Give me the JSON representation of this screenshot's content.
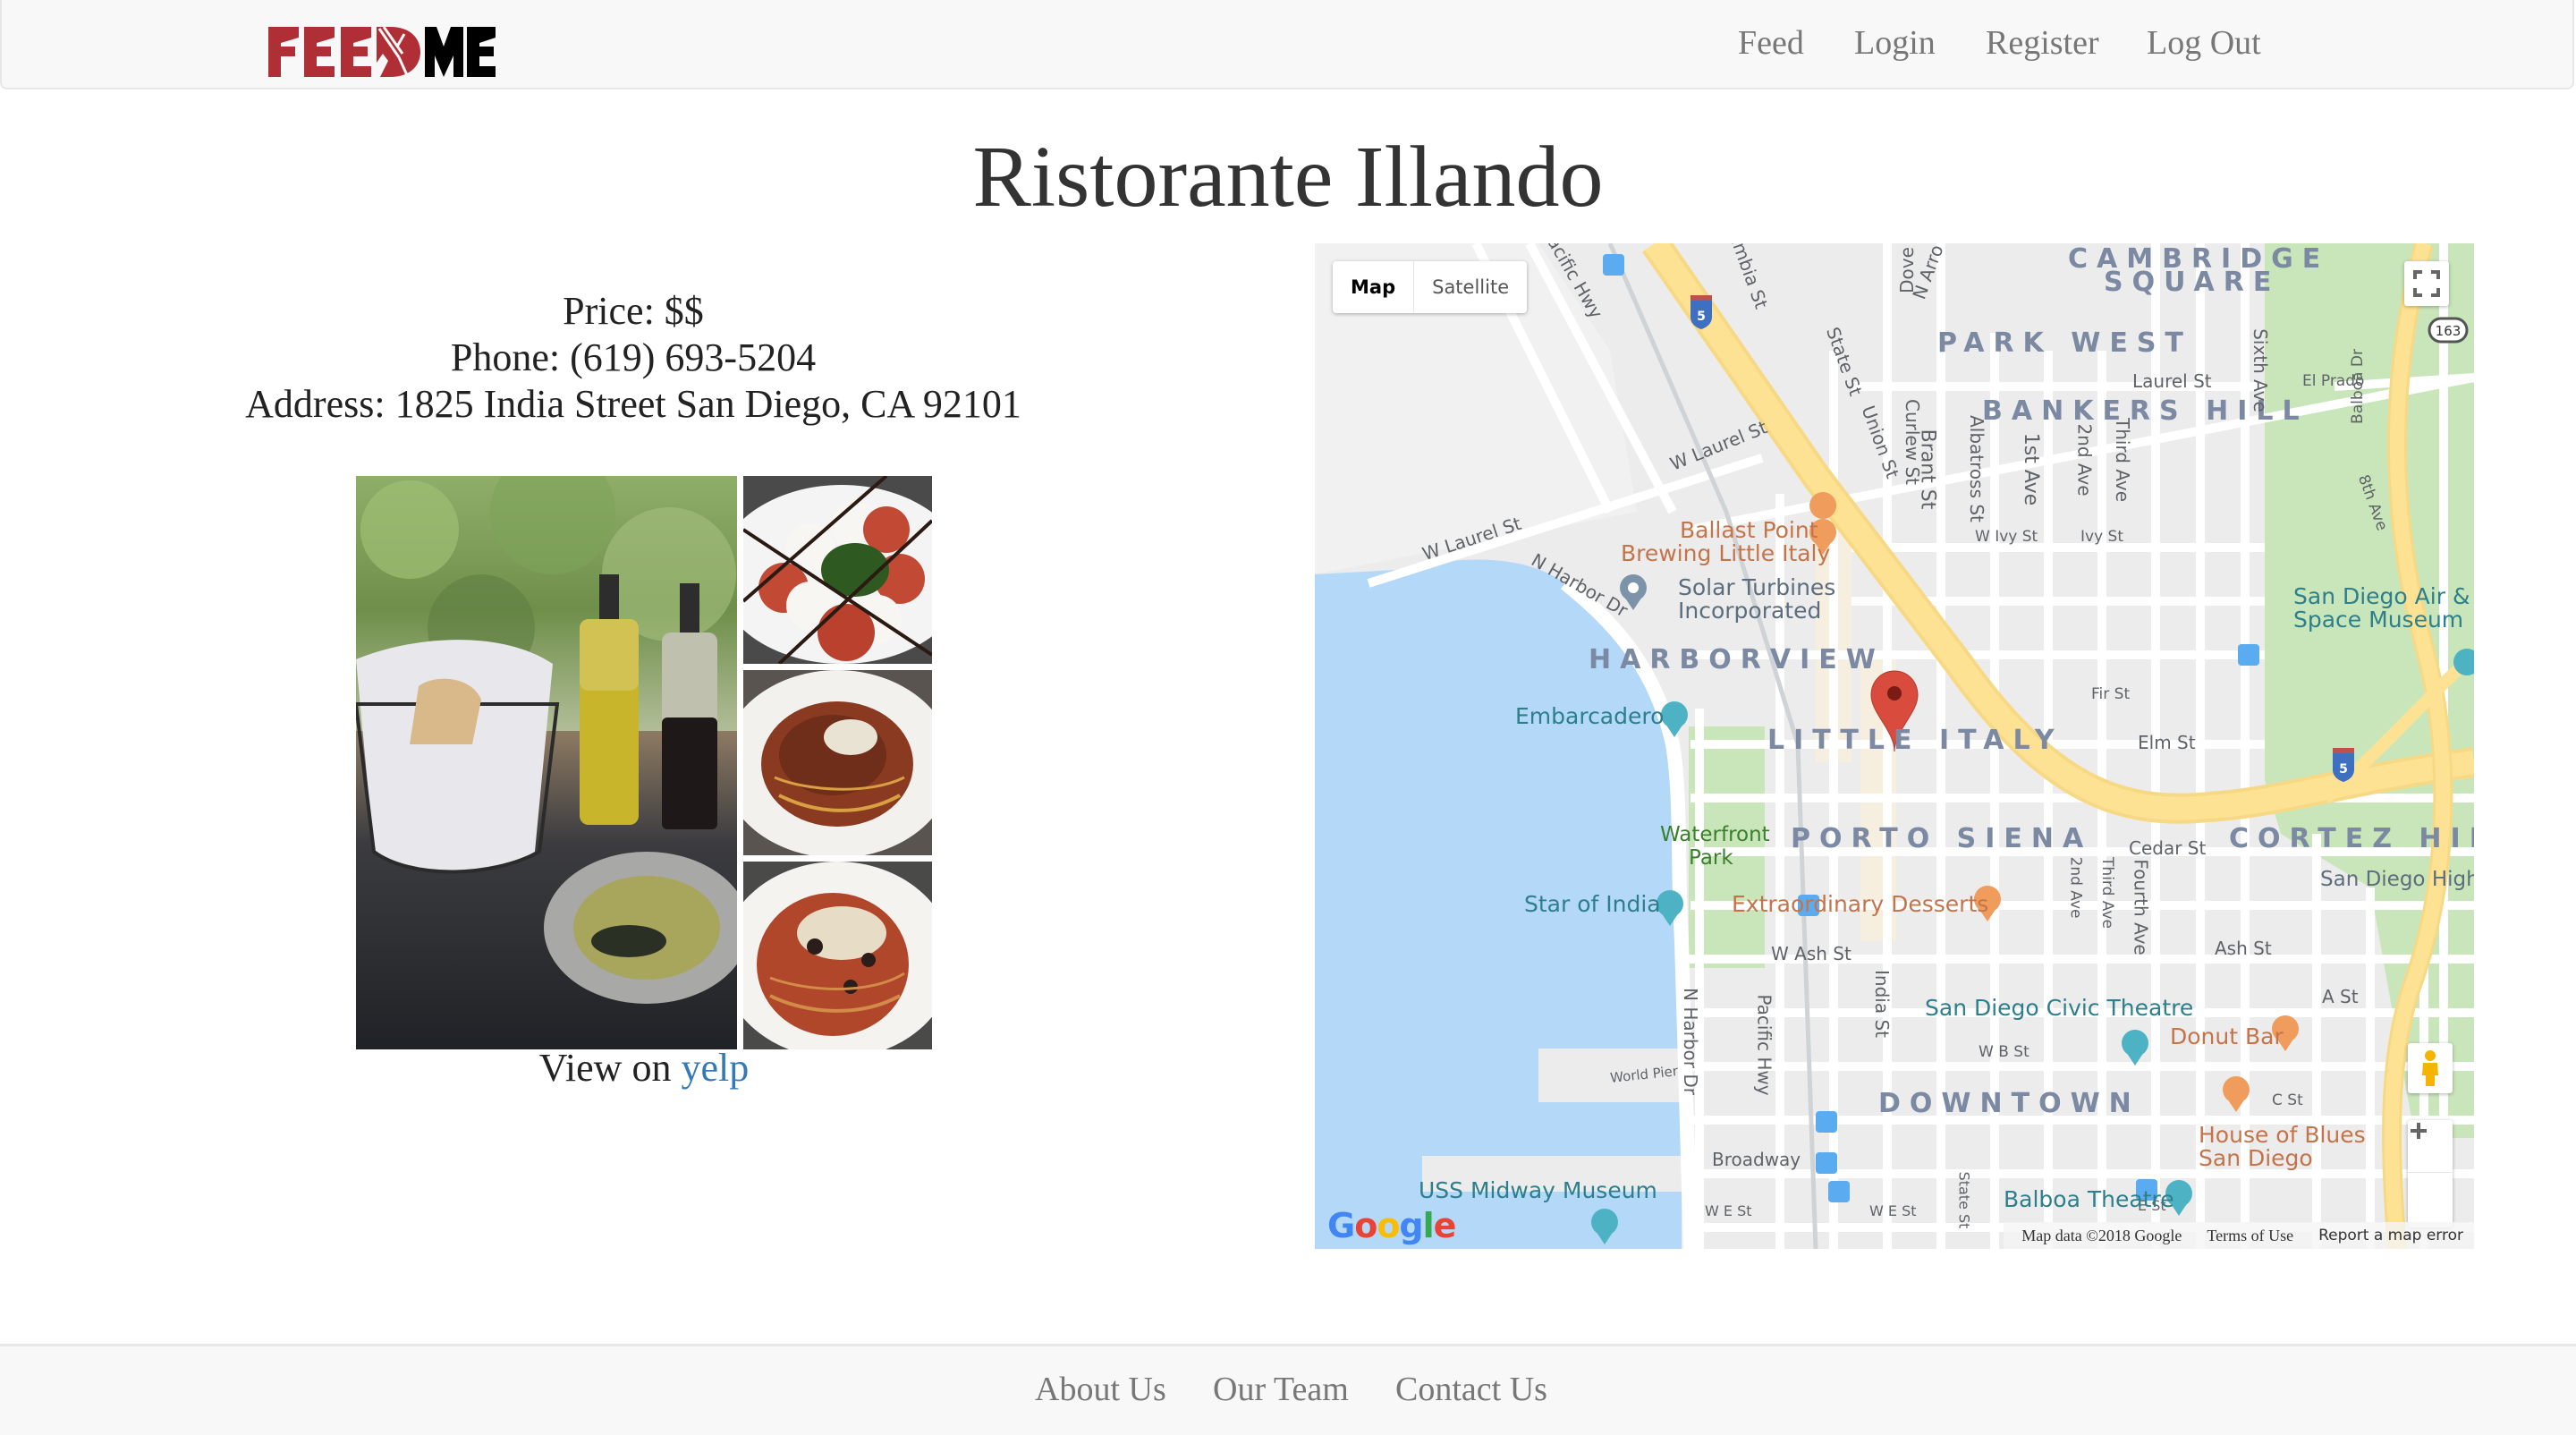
{
  "navbar": {
    "logo": {
      "part1": "FEED",
      "part2": "ME",
      "icon": "fork-knife-icon",
      "brand_color": "#b02e35"
    },
    "links": [
      {
        "label": "Feed"
      },
      {
        "label": "Login"
      },
      {
        "label": "Register"
      },
      {
        "label": "Log Out"
      }
    ]
  },
  "restaurant": {
    "name": "Ristorante Illando",
    "price": "Price: $$",
    "phone": "Phone: (619) 693-5204",
    "address": "Address: 1825 India Street San Diego, CA 92101",
    "view_on_prefix": "View on",
    "view_on_link": "yelp",
    "photos": [
      {
        "alt": "bread basket with olive oil and balsamic bottles"
      },
      {
        "alt": "caprese salad with balsamic drizzle"
      },
      {
        "alt": "spaghetti bolognese with parmesan"
      },
      {
        "alt": "spaghetti with tomato sauce and olives"
      }
    ]
  },
  "map": {
    "type_controls": {
      "map": "Map",
      "satellite": "Satellite",
      "active": "Map"
    },
    "districts": [
      "CAMBRIDGE SQUARE",
      "PARK WEST",
      "BANKERS HILL",
      "HARBORVIEW",
      "LITTLE ITALY",
      "PORTO SIENA",
      "CORTEZ HILL",
      "DOWNTOWN"
    ],
    "cambridge1": "CAMBRIDGE",
    "cambridge2": "SQUARE",
    "streets": {
      "pacific_hwy_top": "acific Hwy",
      "columbia": "umbia St",
      "dove": "Dove",
      "n_arroyo": "N Arro",
      "state": "State St",
      "union": "Union St",
      "curlew": "Curlew St",
      "brant": "Brant St",
      "albatross": "Albatross St",
      "first": "1st Ave",
      "second": "2nd Ave",
      "third": "Third Ave",
      "sixth": "Sixth Ave",
      "balboa": "Balboa Dr",
      "eighth": "8th Ave",
      "laurel": "Laurel St",
      "el_prado": "El Prado",
      "w_laurel1": "W Laurel St",
      "w_laurel2": "W Laurel St",
      "n_harbor1": "N Harbor Dr",
      "w_ivy": "W Ivy St",
      "ivy": "Ivy St",
      "fir": "Fir St",
      "elm": "Elm St",
      "cedar": "Cedar St",
      "second_b": "2nd Ave",
      "third_b": "Third Ave",
      "fourth": "Fourth Ave",
      "w_ash": "W Ash St",
      "ash": "Ash St",
      "a_st": "A St",
      "n_harbor2": "N Harbor Dr",
      "pacific_hwy": "Pacific Hwy",
      "india": "India St",
      "w_b": "W B St",
      "c_st": "C St",
      "world_pier": "World Pier",
      "broadway": "Broadway",
      "w_e1": "W E St",
      "w_e2": "W E St",
      "state2": "State St",
      "e_st": "E St"
    },
    "pois": {
      "ballast1": "Ballast Point",
      "ballast2": "Brewing Little Italy",
      "solar1": "Solar Turbines",
      "solar2": "Incorporated",
      "embarcadero": "Embarcadero",
      "waterfront1": "Waterfront",
      "waterfront2": "Park",
      "extraordinary": "Extraordinary Desserts",
      "star_of_india": "Star of India",
      "air_space1": "San Diego Air &",
      "air_space2": "Space Museum",
      "civic": "San Diego Civic Theatre",
      "donut": "Donut Bar",
      "hob1": "House of Blues",
      "hob2": "San Diego",
      "balboa_theatre": "Balboa Theatre",
      "midway": "USS Midway Museum",
      "sd_high": "San Diego High"
    },
    "shields": {
      "i5": "5",
      "ca163": "163"
    },
    "google": "Google",
    "attribution": {
      "data": "Map data ©2018 Google",
      "terms": "Terms of Use",
      "report": "Report a map error"
    },
    "colors": {
      "water": "#b3d8f8",
      "park": "#c8e6b9",
      "highway": "#fde293",
      "marker": "#d94c3d"
    }
  },
  "footer": {
    "links": [
      {
        "label": "About Us"
      },
      {
        "label": "Our Team"
      },
      {
        "label": "Contact Us"
      }
    ]
  }
}
